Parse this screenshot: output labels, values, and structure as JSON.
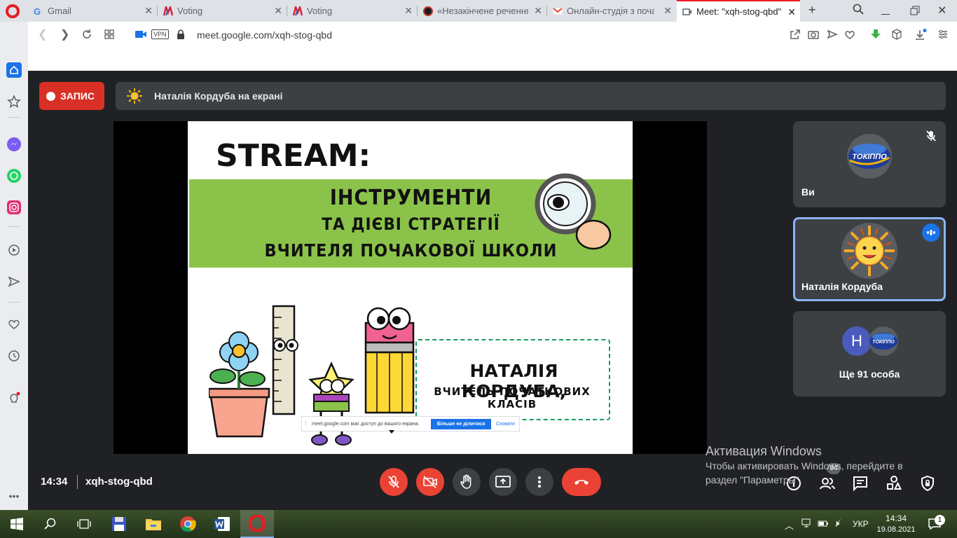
{
  "browser": {
    "tabs": [
      {
        "title": "Gmail",
        "active": false
      },
      {
        "title": "Voting",
        "active": false
      },
      {
        "title": "Voting",
        "active": false
      },
      {
        "title": "«Незакінчене речення»",
        "active": false
      },
      {
        "title": "Онлайн-студія з початк",
        "active": false
      },
      {
        "title": "Meet: \"xqh-stog-qbd\"",
        "active": true
      }
    ],
    "url": "meet.google.com/xqh-stog-qbd",
    "vpn_badge": "VPN"
  },
  "meet": {
    "record_label": "ЗАПИС",
    "presenting_text": "Наталія Кордуба на екрані",
    "time": "14:34",
    "meeting_code": "xqh-stog-qbd",
    "participants_count": "94",
    "tiles": [
      {
        "name": "Ви",
        "muted": true
      },
      {
        "name": "Наталія Кордуба",
        "speaking": true
      },
      {
        "name": "Ще 91 особа",
        "initial": "H"
      }
    ]
  },
  "slide": {
    "heading": "STREAM:",
    "banner_lines": [
      "ІНСТРУМЕНТИ",
      "ТА ДІЄВІ СТРАТЕГІЇ",
      "ВЧИТЕЛЯ ПОЧАКОВОЇ ШКОЛИ"
    ],
    "presenter_name": "НАТАЛІЯ КОРДУБА,",
    "presenter_role": "ВЧИТЕЛЬ ПОЧАТКОВИХ КЛАСІВ"
  },
  "share_notice": {
    "text": "meet.google.com має доступ до вашого екрана.",
    "stop_label": "Більше не ділитися",
    "hide_label": "Сховати"
  },
  "windows_activation": {
    "title": "Активация Windows",
    "line1": "Чтобы активировать Windows, перейдите в",
    "line2": "раздел \"Параметры\"."
  },
  "logos": {
    "participant_logo_text": "ТОКІППО"
  },
  "taskbar": {
    "language": "УКР",
    "time": "14:34",
    "date": "19.08.2021",
    "notifications": "1"
  },
  "colors": {
    "opera_red": "#e81b23",
    "meet_bg": "#202124",
    "record_red": "#d93025",
    "banner_green": "#8bc34a",
    "speaker_blue": "#8ab4f8"
  }
}
